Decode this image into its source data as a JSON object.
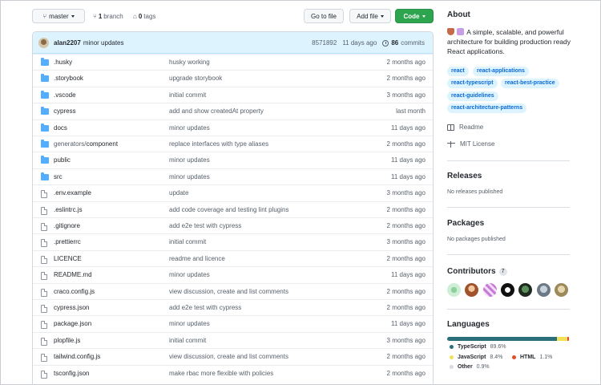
{
  "topbar": {
    "branch": "master",
    "branch_count": "1",
    "branch_word": "branch",
    "tag_count": "0",
    "tag_word": "tags",
    "go_to_file": "Go to file",
    "add_file": "Add file",
    "code": "Code"
  },
  "commit": {
    "user": "alan2207",
    "message": "minor updates",
    "hash": "8571892",
    "age": "11 days ago",
    "count": "86",
    "count_word": "commits"
  },
  "files": [
    {
      "name": ".husky",
      "type": "folder",
      "message": "husky working",
      "age": "2 months ago"
    },
    {
      "name": ".storybook",
      "type": "folder",
      "message": "upgrade storybook",
      "age": "2 months ago"
    },
    {
      "name": ".vscode",
      "type": "folder",
      "message": "initial commit",
      "age": "3 months ago"
    },
    {
      "name": "cypress",
      "type": "folder",
      "message": "add and show createdAt property",
      "age": "last month"
    },
    {
      "name": "docs",
      "type": "folder",
      "message": "minor updates",
      "age": "11 days ago"
    },
    {
      "name_dim": "generators/",
      "name": "component",
      "type": "folder",
      "message": "replace interfaces with type aliases",
      "age": "2 months ago"
    },
    {
      "name": "public",
      "type": "folder",
      "message": "minor updates",
      "age": "11 days ago"
    },
    {
      "name": "src",
      "type": "folder",
      "message": "minor updates",
      "age": "11 days ago"
    },
    {
      "name": ".env.example",
      "type": "file",
      "message": "update",
      "age": "3 months ago"
    },
    {
      "name": ".eslintrc.js",
      "type": "file",
      "message": "add code coverage and testing lint plugins",
      "age": "2 months ago"
    },
    {
      "name": ".gitignore",
      "type": "file",
      "message": "add e2e test with cypress",
      "age": "2 months ago"
    },
    {
      "name": ".prettierrc",
      "type": "file",
      "message": "initial commit",
      "age": "3 months ago"
    },
    {
      "name": "LICENCE",
      "type": "file",
      "message": "readme and licence",
      "age": "2 months ago"
    },
    {
      "name": "README.md",
      "type": "file",
      "message": "minor updates",
      "age": "11 days ago"
    },
    {
      "name": "craco.config.js",
      "type": "file",
      "message": "view discussion, create and list comments",
      "age": "2 months ago"
    },
    {
      "name": "cypress.json",
      "type": "file",
      "message": "add e2e test with cypress",
      "age": "2 months ago"
    },
    {
      "name": "package.json",
      "type": "file",
      "message": "minor updates",
      "age": "11 days ago"
    },
    {
      "name": "plopfile.js",
      "type": "file",
      "message": "initial commit",
      "age": "3 months ago"
    },
    {
      "name": "tailwind.config.js",
      "type": "file",
      "message": "view discussion, create and list comments",
      "age": "2 months ago"
    },
    {
      "name": "tsconfig.json",
      "type": "file",
      "message": "make rbac more flexible with policies",
      "age": "2 months ago"
    }
  ],
  "about": {
    "heading": "About",
    "description": "A simple, scalable, and powerful architecture for building production ready React applications.",
    "topics": [
      "react",
      "react-applications",
      "react-typescript",
      "react-best-practice",
      "react-guidelines",
      "react-architecture-patterns"
    ],
    "readme": "Readme",
    "license": "MIT License"
  },
  "releases": {
    "heading": "Releases",
    "text": "No releases published"
  },
  "packages": {
    "heading": "Packages",
    "text": "No packages published"
  },
  "contributors": {
    "heading": "Contributors",
    "count": "7"
  },
  "languages": {
    "heading": "Languages",
    "items": [
      {
        "name": "TypeScript",
        "percent": "89.6%",
        "value": 89.6,
        "color": "#3178c6"
      },
      {
        "name": "JavaScript",
        "percent": "8.4%",
        "value": 8.4,
        "color": "#f1e05a"
      },
      {
        "name": "HTML",
        "percent": "1.1%",
        "value": 1.1,
        "color": "#e34c26"
      },
      {
        "name": "Other",
        "percent": "0.9%",
        "value": 0.9,
        "color": "#ededed"
      }
    ]
  },
  "colors": {
    "accent": "#0969da",
    "code_button": "#2da44e",
    "folder": "#54aeff"
  }
}
